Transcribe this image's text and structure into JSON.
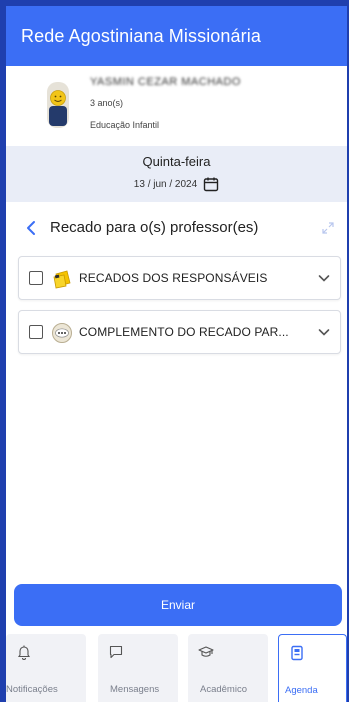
{
  "app": {
    "title": "Rede Agostiniana Missionária"
  },
  "student": {
    "name": "YASMIN CEZAR MACHADO",
    "year": "3 ano(s)",
    "class": "Educação Infantil"
  },
  "date": {
    "weekday": "Quinta-feira",
    "date": "13 / jun / 2024"
  },
  "section": {
    "title": "Recado para o(s) professor(es)"
  },
  "items": [
    {
      "label": "RECADOS DOS RESPONSÁVEIS",
      "icon": "note-icon",
      "checked": false
    },
    {
      "label": "COMPLEMENTO DO RECADO PAR...",
      "icon": "chat-bubble-icon",
      "checked": false
    }
  ],
  "actions": {
    "send_label": "Enviar"
  },
  "tabs": [
    {
      "label": "Notificações",
      "icon": "bell-icon",
      "active": false
    },
    {
      "label": "Mensagens",
      "icon": "message-icon",
      "active": false
    },
    {
      "label": "Acadêmico",
      "icon": "graduation-cap-icon",
      "active": false
    },
    {
      "label": "Agenda",
      "icon": "agenda-icon",
      "active": true
    }
  ],
  "colors": {
    "primary": "#3b6ef5",
    "frame": "#1f3fae",
    "datebar": "#e9edf7"
  }
}
